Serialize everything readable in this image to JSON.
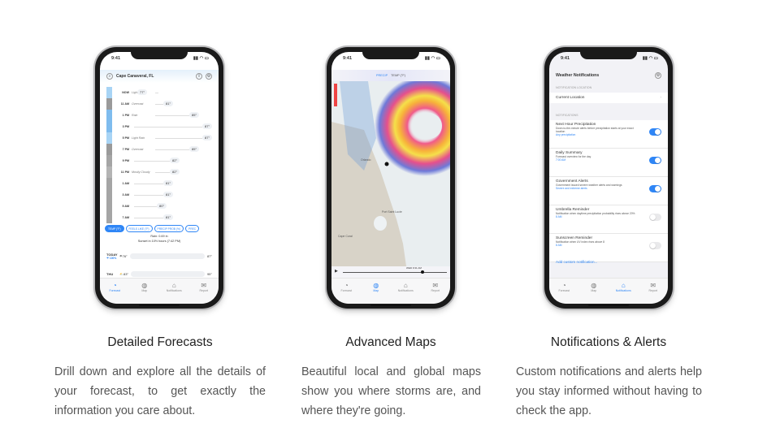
{
  "colors": {
    "accent": "#2f86f6",
    "heading": "#222222",
    "body_text": "#555555"
  },
  "phones": {
    "status_time": "9:41",
    "tabs": [
      {
        "label": "Forecast",
        "icon": "forecast-icon"
      },
      {
        "label": "Map",
        "icon": "globe-icon"
      },
      {
        "label": "Notifications",
        "icon": "notifications-icon"
      },
      {
        "label": "Report",
        "icon": "report-icon"
      }
    ]
  },
  "forecast": {
    "location": "Cape Canaveral, FL",
    "rows": [
      {
        "time": "NOW",
        "cond": "Light Rain",
        "temp": "77°",
        "color": "#a8d4f5"
      },
      {
        "time": "11 AM",
        "cond": "Overcast",
        "temp": "81°",
        "color": "#9a9a9a"
      },
      {
        "time": "1 PM",
        "cond": "Rain",
        "temp": "85°",
        "color": "#7fbcee"
      },
      {
        "time": "3 PM",
        "cond": "",
        "temp": "87°",
        "color": "#7fbcee"
      },
      {
        "time": "5 PM",
        "cond": "Light Rain",
        "temp": "87°",
        "color": "#a8d4f5"
      },
      {
        "time": "7 PM",
        "cond": "Overcast",
        "temp": "85°",
        "color": "#9a9a9a"
      },
      {
        "time": "9 PM",
        "cond": "",
        "temp": "82°",
        "color": "#a5a5a5"
      },
      {
        "time": "11 PM",
        "cond": "Mostly Cloudy",
        "temp": "82°",
        "color": "#b4b4b4"
      },
      {
        "time": "1 AM",
        "cond": "",
        "temp": "81°",
        "color": "#a5a5a5"
      },
      {
        "time": "3 AM",
        "cond": "",
        "temp": "81°",
        "color": "#a5a5a5"
      },
      {
        "time": "5 AM",
        "cond": "",
        "temp": "80°",
        "color": "#a5a5a5"
      },
      {
        "time": "7 AM",
        "cond": "",
        "temp": "81°",
        "color": "#a5a5a5"
      }
    ],
    "pills": [
      "TEMP (°F)",
      "FEELS LIKE (°F)",
      "PRECIP PROB (%)",
      "PREC"
    ],
    "rain": "Rain: 0.69 in",
    "sunset": "Sunset in 10½ hours (7:42 PM)",
    "days": [
      {
        "name": "TODAY",
        "sub": "☂ 100%",
        "low": "76°",
        "high": "87°"
      },
      {
        "name": "THU",
        "sub": "",
        "low": "83°",
        "high": "95°"
      }
    ]
  },
  "map": {
    "tabs": [
      "PRECIP",
      "TEMP (°F)"
    ],
    "places": [
      "Orlando",
      "Port Saint Lucie",
      "Cape Coral"
    ],
    "timeline_label": "WED 9:31 AM"
  },
  "notifications": {
    "title": "Weather Notifications",
    "location_header": "NOTIFICATION LOCATION",
    "location": "Current Location",
    "section_header": "NOTIFICATIONS",
    "items": [
      {
        "title": "Next Hour Precipitation",
        "desc": "Down-to-the-minute alerts before precipitation starts at your exact location",
        "link": "Any precipitation",
        "on": true
      },
      {
        "title": "Daily Summary",
        "desc": "Forecast overview for the day",
        "link": "7:00 AM",
        "on": true
      },
      {
        "title": "Government Alerts",
        "desc": "Government issued severe weather alerts and warnings",
        "link": "Severe and extreme alerts",
        "on": true
      },
      {
        "title": "Umbrella Reminder",
        "desc": "Notification when daytime precipitation probability rises above 20%",
        "link": "8 AM",
        "on": false
      },
      {
        "title": "Sunscreen Reminder",
        "desc": "Notification when UV index rises above 8",
        "link": "8 AM",
        "on": false
      }
    ],
    "add": "Add custom notification..."
  },
  "features": [
    {
      "title": "Detailed Forecasts",
      "desc": "Drill down and explore all the details of your forecast, to get exactly the information you care about."
    },
    {
      "title": "Advanced Maps",
      "desc": "Beautiful local and global maps show you where storms are, and where they're going."
    },
    {
      "title": "Notifications & Alerts",
      "desc": "Custom notifications and alerts help you stay informed without having to check the app."
    }
  ]
}
